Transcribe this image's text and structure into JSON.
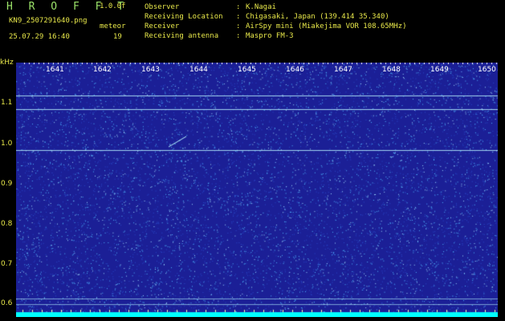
{
  "header": {
    "app_title": "H R O F F T",
    "version": "1.0.0f",
    "file_name": "KN9_2507291640.png",
    "timestamp": "25.07.29 16:40",
    "meteor_label": "meteor",
    "meteor_count": "19",
    "info": [
      {
        "key": "Observer",
        "sep": ":",
        "value": "K.Nagai"
      },
      {
        "key": "Receiving Location",
        "sep": ":",
        "value": "Chigasaki, Japan (139.414 35.340)"
      },
      {
        "key": "Receiver",
        "sep": ":",
        "value": "AirSpy mini (Miakejima VOR 108.65MHz)"
      },
      {
        "key": "Receiving antenna",
        "sep": ":",
        "value": "Maspro FM-3"
      }
    ]
  },
  "spectrogram": {
    "unit_label": "kHz",
    "y_ticks": [
      "1.1",
      "1.0",
      "0.9",
      "0.8",
      "0.7",
      "0.6"
    ],
    "x_ticks": [
      "1641",
      "1642",
      "1643",
      "1644",
      "1645",
      "1646",
      "1647",
      "1648",
      "1649",
      "1650"
    ],
    "background_color": "#1b1f96",
    "noise_color": "#4fb6ff",
    "carrier_color": "#b8f5ff",
    "baseline_color": "#00ffff"
  }
}
